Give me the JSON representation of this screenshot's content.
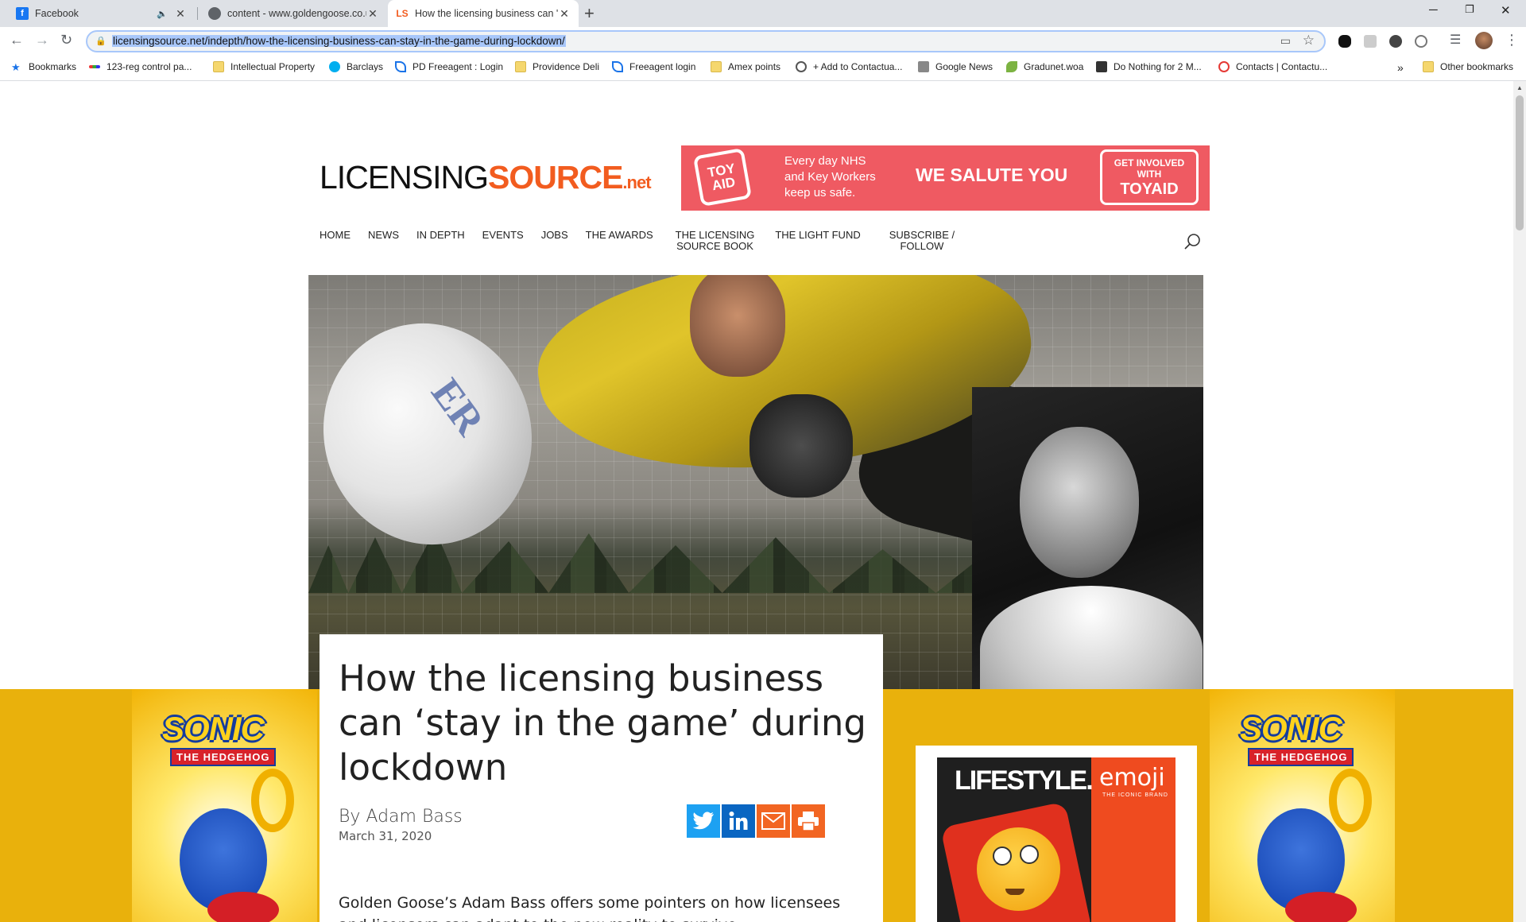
{
  "browser": {
    "tabs": [
      {
        "title": "Facebook",
        "icon": "facebook-icon",
        "muted_indicator": "◀ᐧ"
      },
      {
        "title": "content - www.goldengoose.co.u",
        "icon": "globe-icon"
      },
      {
        "title": "How the licensing business can 's",
        "icon": "ls-favicon",
        "favicon_text": "LS",
        "active": true
      }
    ],
    "url": "licensingsource.net/indepth/how-the-licensing-business-can-stay-in-the-game-during-lockdown/",
    "bookmarks": [
      {
        "label": "Bookmarks",
        "icon": "star-icon"
      },
      {
        "label": "123-reg control pa...",
        "icon": "dots-icon"
      },
      {
        "label": "Intellectual Property",
        "icon": "folder-icon"
      },
      {
        "label": "Barclays",
        "icon": "eagle-icon"
      },
      {
        "label": "PD Freeagent : Login",
        "icon": "freeagent-icon"
      },
      {
        "label": "Providence Deli",
        "icon": "folder-icon"
      },
      {
        "label": "Freeagent login",
        "icon": "freeagent-icon"
      },
      {
        "label": "Amex points",
        "icon": "folder-icon"
      },
      {
        "label": "+ Add to Contactua...",
        "icon": "globe-icon"
      },
      {
        "label": "Google News",
        "icon": "news-icon"
      },
      {
        "label": "Gradunet.woa",
        "icon": "leaf-icon"
      },
      {
        "label": "Do Nothing for 2 M...",
        "icon": "video-icon"
      },
      {
        "label": "Contacts | Contactu...",
        "icon": "contacts-icon"
      }
    ],
    "overflow_label": "»",
    "other_bookmarks": "Other bookmarks"
  },
  "site": {
    "logo": {
      "part1": "LICENSING",
      "part2": "SOURCE",
      "part3": ".net"
    },
    "banner": {
      "badge_text": "TOY AID",
      "line1": "Every day NHS",
      "line2": "and Key Workers",
      "line3": "keep us safe.",
      "headline": "WE SALUTE YOU",
      "cta_small": "GET INVOLVED WITH",
      "cta_big": "TOYAID"
    },
    "nav": [
      {
        "line1": "HOME",
        "line2": ""
      },
      {
        "line1": "NEWS",
        "line2": ""
      },
      {
        "line1": "IN DEPTH",
        "line2": ""
      },
      {
        "line1": "EVENTS",
        "line2": ""
      },
      {
        "line1": "JOBS",
        "line2": ""
      },
      {
        "line1": "THE AWARDS",
        "line2": ""
      },
      {
        "line1": "THE LICENSING",
        "line2": "SOURCE BOOK"
      },
      {
        "line1": "THE LIGHT FUND",
        "line2": ""
      },
      {
        "line1": "SUBSCRIBE /",
        "line2": "FOLLOW"
      }
    ]
  },
  "hero": {
    "ball_text": "ER"
  },
  "article": {
    "headline": "How the licensing business can ‘stay in the game’ during lockdown",
    "byline": "By Adam Bass",
    "date": "March 31, 2020",
    "standfirst": "Golden Goose’s Adam Bass offers some pointers on how licensees and licensors can adapt to the new reality to survive..."
  },
  "ads": {
    "sonic": {
      "brand": "SONIC",
      "sub": "THE HEDGEHOG"
    },
    "lifestyle": {
      "title": "LIFESTYLE.",
      "brand": "emoji",
      "brand_sub": "THE ICONIC BRAND"
    }
  },
  "colors": {
    "accent": "#f25c1f",
    "banner": "#ef5a62",
    "yellow": "#e9b10c",
    "twitter": "#1da1f2",
    "linkedin": "#0a66c2",
    "email": "#f26522",
    "print": "#f26522"
  }
}
